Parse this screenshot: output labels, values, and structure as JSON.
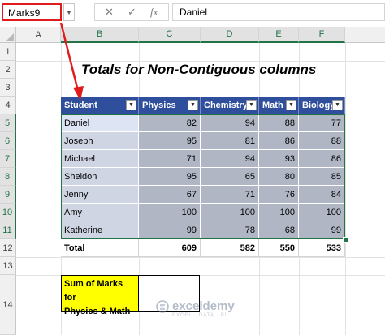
{
  "formula_bar": {
    "name_box": "Marks9",
    "cancel_icon": "✕",
    "enter_icon": "✓",
    "fx_label": "fx",
    "content": "Daniel"
  },
  "grid": {
    "columns": [
      "A",
      "B",
      "C",
      "D",
      "E",
      "F"
    ],
    "rows": [
      "1",
      "2",
      "3",
      "4",
      "5",
      "6",
      "7",
      "8",
      "9",
      "10",
      "11",
      "12",
      "13",
      "14"
    ]
  },
  "title": "Totals for Non-Contiguous columns",
  "table": {
    "headers": [
      "Student",
      "Physics",
      "Chemistry",
      "Math",
      "Biology"
    ],
    "rows": [
      [
        "Daniel",
        "82",
        "94",
        "88",
        "77"
      ],
      [
        "Joseph",
        "95",
        "81",
        "86",
        "88"
      ],
      [
        "Michael",
        "71",
        "94",
        "93",
        "86"
      ],
      [
        "Sheldon",
        "95",
        "65",
        "80",
        "85"
      ],
      [
        "Jenny",
        "67",
        "71",
        "76",
        "84"
      ],
      [
        "Amy",
        "100",
        "100",
        "100",
        "100"
      ],
      [
        "Katherine",
        "99",
        "78",
        "68",
        "99"
      ]
    ],
    "total": [
      "Total",
      "609",
      "582",
      "550",
      "533"
    ]
  },
  "sum_box": {
    "line1": "Sum of Marks for",
    "line2": "Physics & Math",
    "value": ""
  },
  "watermark": {
    "name": "exceldemy",
    "tagline": "EXCEL · DATA · BI"
  },
  "colors": {
    "header_bg": "#2f4f9c",
    "name_cell": "#cfd5e2",
    "number_cell": "#b0b6c4",
    "selection": "#217346",
    "name_box_border": "#e11b1b",
    "sum_label_bg": "#ffff00"
  }
}
